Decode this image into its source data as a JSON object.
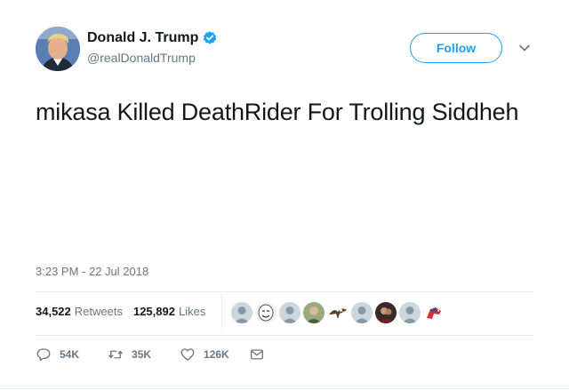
{
  "author": {
    "display_name": "Donald J. Trump",
    "handle": "@realDonaldTrump",
    "verified": true,
    "avatar_icon": "avatar-portrait"
  },
  "header": {
    "follow_label": "Follow",
    "menu_icon": "chevron-down-icon"
  },
  "tweet": {
    "text": "mikasa Killed DeathRider For Trolling Siddheh",
    "timestamp": "3:23 PM - 22 Jul 2018"
  },
  "stats": {
    "retweets_count": "34,522",
    "retweets_label": "Retweets",
    "likes_count": "125,892",
    "likes_label": "Likes"
  },
  "likers": [
    {
      "icon": "default-avatar"
    },
    {
      "icon": "meme-face-avatar"
    },
    {
      "icon": "default-avatar"
    },
    {
      "icon": "person-avatar"
    },
    {
      "icon": "eagle-avatar"
    },
    {
      "icon": "default-avatar"
    },
    {
      "icon": "person-avatar-dark"
    },
    {
      "icon": "default-avatar"
    },
    {
      "icon": "mascot-avatar"
    }
  ],
  "actions": {
    "reply_count": "54K",
    "retweet_count": "35K",
    "like_count": "126K"
  },
  "colors": {
    "accent": "#1da1f2",
    "text_primary": "#14171a",
    "text_secondary": "#657786",
    "border": "#e6ecf0"
  }
}
